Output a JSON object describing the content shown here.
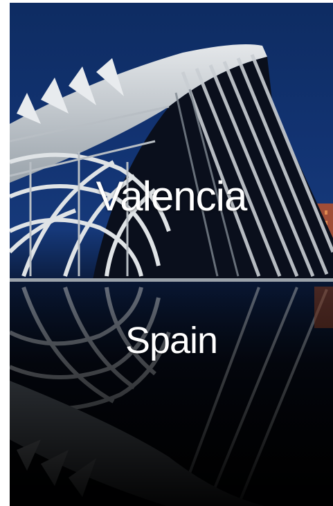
{
  "photo": {
    "title": "Valencia",
    "subtitle": "Spain",
    "colors": {
      "sky_top": "#0e2c62",
      "sky_mid": "#16397a",
      "structure": "#d9dde0",
      "water": "#020306",
      "accent_orange": "#c0532a"
    }
  }
}
